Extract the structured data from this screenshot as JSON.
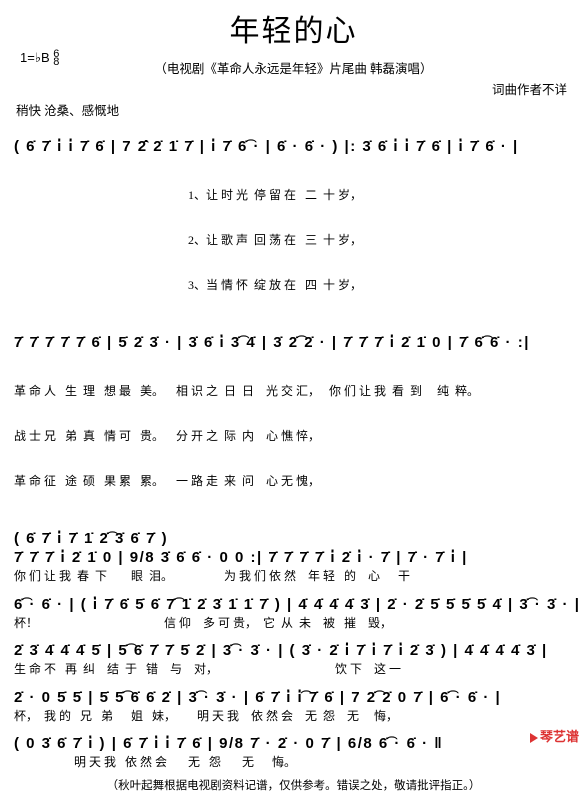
{
  "title": "年轻的心",
  "subtitle": "（电视剧《革命人永远是年轻》片尾曲 韩磊演唱）",
  "keysig_text": "1=♭B",
  "timesig_a": "6",
  "timesig_b": "8",
  "credit": "词曲作者不详",
  "tempo": "稍快 沧桑、感慨地",
  "lines": {
    "n1": "( 6̇ 7̇ i̇  i̇ 7̇ 6̇ | 7  2̇̂ 2̇ 1̇ 7̇ | i̇ 7̇ 6̇͡ · | 6̇ · 6̇ · ) |: 3̇ 6̇ i̇  i̇ 7̇ 6̇ | i̇  7̇ 6̇ ·  |",
    "l1a": "                                                          1、让 时 光  停 留 在   二  十 岁，",
    "l1b": "                                                          2、让 歌 声  回 荡 在   三  十 岁，",
    "l1c": "                                                          3、当 情 怀  绽 放 在   四  十 岁，",
    "n2": "7̇ 7̇ 7̇  7̇ 7̇ 6̇ | 5̇ 2̇  3̇ ·  | 3̇ 6̇ i̇  3̇͡ 4̇ | 3̇ 2̇͡ 2̇ ·   | 7̇ 7̇ 7̇ i̇  2̇ 1̇ 0 | 7̇ 6̇͡ 6̇ · :|",
    "l2a": "革 命 人   生  理   想 最   美。    相 识 之  日  日    光 交 汇，   你 们 让 我  看  到     纯  粹。",
    "l2b": "战 士 兄   弟  真   情 可   贵。    分 开 之  际  内    心 憔 悴，",
    "l2c": "革 命 征   途  硕   果 累   累。    一 路 走  来  问    心 无 愧，",
    "mid": "                               ( 6̇ 7̇ i̇ 7̇ 1̇ 2̇͡  3̇ 6̇ 7̇ )",
    "n3": "7̇ 7̇ 7̇ i̇  2̇ 1̇ 0 | 9/8 3̇  6̇  6̇ ·     0 0   :|  7̇ 7̇ 7̇ 7̇ i̇  2̇ i̇ · 7̇ | 7̇ ·  7̇ i̇ |",
    "l3": "你 们 让 我  春  下        眼  泪。                 为 我 们 依 然    年 轻   的    心      干",
    "n4": "6̇͡ · 6̇ ·  | ( i̇ 7̇ 6̇ 5̇ 6̇ 7̇͡  1̇ 2̇ 3̇ 1̇ 1̇ 7̇ ) | 4̇ 4̇  4̇ 4̇ 3̇ | 2̇ · 2̇ 5̇  5̇ 5̇  5̇ 4̇ | 3̇͡ · 3̇ ·  |",
    "l4": "杯！                                          信 仰    多 可 贵，  它  从  未    被   摧    毁，",
    "n5": "2̇ 3̇ 4̇  4̇ 4̇ 5̇ | 5̇͡ 6̇  7̇  7̇ 5̇ 2̇ | 3̇͡ · 3̇ ·  | ( 3̇ ·  2̇ i̇ 7̇ i̇ 7̇ i̇ 2̇ 3̇ ) | 4̇ 4̇  4̇ 4̇ 3̇ |",
    "l5": "生 命 不   再  纠    结  于   错    与    对，                                       饮 下    这 一",
    "n6": "2̇ · 0 5̇ 5̇ | 5̇  5̇͡ 6̇  6̇ 2̇ | 3̇͡ · 3̇ ·  |  6̇ 7̇ i̇   i̇͡ 7̇ 6̇ | 7  2̇͡ 2̇ 0 7̇ | 6̇͡ · 6̇ ·  |",
    "l6": "杯，  我 的   兄   弟      姐   妹，       明 天 我    依 然 会    无  怨    无     悔，",
    "n7": "( 0 3̇ 6̇ 7̇  i̇ ) | 6̇ 7̇ i̇  i̇ 7̇ 6̇ | 9/8 7̇ ·  2̇ ·   0 7̇ | 6/8 6̇͡ · 6̇ ·  ‖",
    "l7": "                    明 天 我   依 然 会       无   怨       无      悔。"
  },
  "footnote": "（秋叶起舞根据电视剧资料记谱，仅供参考。错误之处，敬请批评指正。）",
  "watermark": "琴艺谱"
}
